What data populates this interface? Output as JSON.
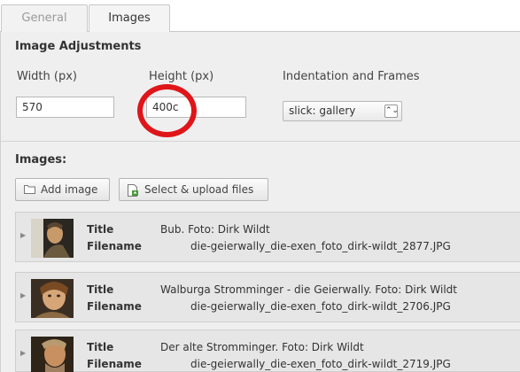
{
  "tabs": [
    {
      "label": "General"
    },
    {
      "label": "Images"
    }
  ],
  "adjustments": {
    "title": "Image Adjustments",
    "width_label": "Width (px)",
    "width_value": "570",
    "height_label": "Height (px)",
    "height_value": "400c",
    "indentation_label": "Indentation and Frames",
    "indentation_value": "slick: gallery"
  },
  "images": {
    "title": "Images:",
    "add_label": "Add image",
    "upload_label": "Select & upload files",
    "title_field_label": "Title",
    "filename_field_label": "Filename",
    "items": [
      {
        "title": "Bub. Foto: Dirk Wildt",
        "filename": "die-geierwally_die-exen_foto_dirk-wildt_2877.JPG"
      },
      {
        "title": "Walburga Stromminger - die Geierwally. Foto: Dirk Wildt",
        "filename": "die-geierwally_die-exen_foto_dirk-wildt_2706.JPG"
      },
      {
        "title": "Der alte Stromminger. Foto: Dirk Wildt",
        "filename": "die-geierwally_die-exen_foto_dirk-wildt_2719.JPG"
      }
    ]
  },
  "annotation": {
    "color": "#e0151a"
  },
  "icons": [
    "folder-icon",
    "upload-file-icon",
    "expand-caret-icon",
    "select-arrow-icon"
  ]
}
